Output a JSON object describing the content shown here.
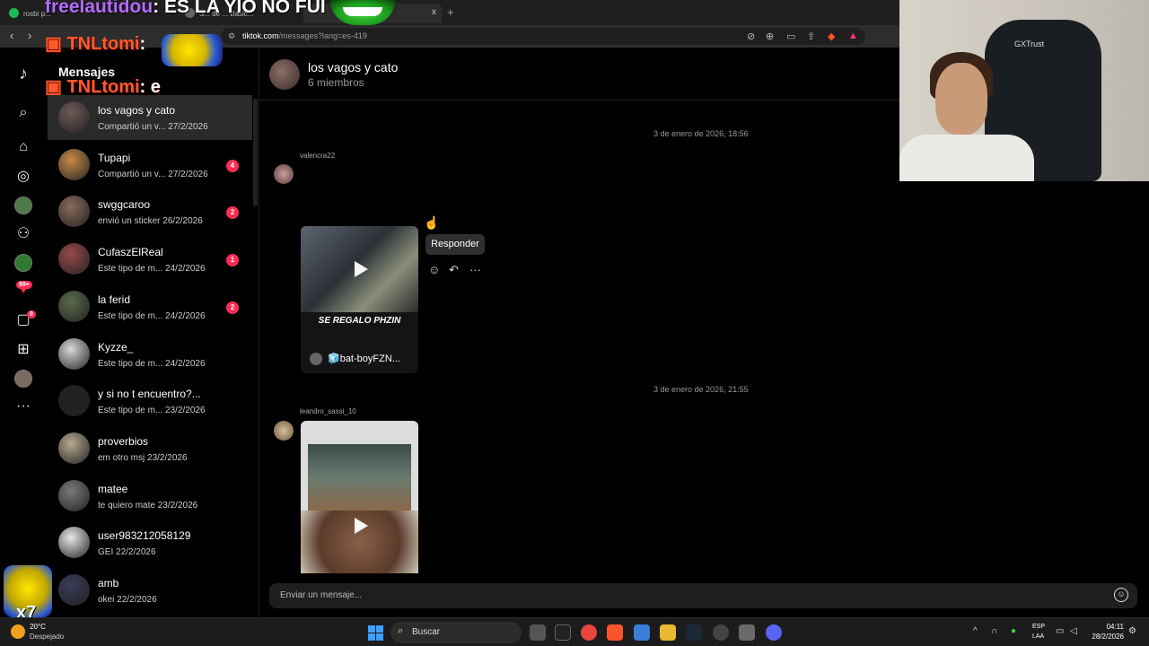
{
  "browser": {
    "tabs": [
      {
        "label": "rosbi p..."
      },
      {
        "label": "S... de ... Basic..."
      },
      {
        "label": "x"
      }
    ],
    "new_tab": "+",
    "url_host": "tiktok.com",
    "url_path": "/messages?lang=es-419",
    "nav": {
      "back": "‹",
      "forward": "›"
    }
  },
  "stream_overlay": {
    "banner_user": "freelautidou",
    "banner_text": ": ES LA YIO NO FUI",
    "tnl_line1_user": "TNLtomi",
    "tnl_line1_text": ":",
    "tnl_line2_user": "TNLtomi",
    "tnl_line2_text": ": e",
    "multiplier": "x7",
    "webcam_chair_brand": "GXTrust"
  },
  "sidebar": {
    "title": "Mensajes",
    "notif_badge": "99+",
    "inbox_badge": "9",
    "more": "···"
  },
  "conversations": [
    {
      "name": "los vagos y cato",
      "preview": "Compartió un v...",
      "date": "27/2/2026",
      "unread": "",
      "color": "#6e5a55"
    },
    {
      "name": "Tupapi",
      "preview": "Compartió un v...",
      "date": "27/2/2026",
      "unread": "4",
      "color": "#c98a4a"
    },
    {
      "name": "swggcaroo",
      "preview": "envió un sticker",
      "date": "26/2/2026",
      "unread": "2",
      "color": "#8a6a5a"
    },
    {
      "name": "CufaszElReal",
      "preview": "Este tipo de m...",
      "date": "24/2/2026",
      "unread": "1",
      "color": "#9a4a4a"
    },
    {
      "name": "la ferid",
      "preview": "Este tipo de m...",
      "date": "24/2/2026",
      "unread": "2",
      "color": "#5a6a4a"
    },
    {
      "name": "Kyzze_",
      "preview": "Este tipo de m...",
      "date": "24/2/2026",
      "unread": "",
      "color": "#d8d8d8"
    },
    {
      "name": "y si no t encuentro?...",
      "preview": "Este tipo de m...",
      "date": "23/2/2026",
      "unread": "",
      "color": "#222222"
    },
    {
      "name": "proverbios",
      "preview": "em otro msj",
      "date": "23/2/2026",
      "unread": "",
      "color": "#b8a890"
    },
    {
      "name": "matee",
      "preview": "te quiero mate",
      "date": "23/2/2026",
      "unread": "",
      "color": "#7a7a7a"
    },
    {
      "name": "user983212058129",
      "preview": "GEI",
      "date": "22/2/2026",
      "unread": "",
      "color": "#e8e8e8"
    },
    {
      "name": "amb",
      "preview": "okei",
      "date": "22/2/2026",
      "unread": "",
      "color": "#3a3a5a"
    }
  ],
  "chat": {
    "group_name": "los vagos y cato",
    "members": "6 miembros",
    "messages": [
      {
        "timestamp": "3 de enero de 2026, 18:56",
        "sender": "valencra22",
        "video_caption": "SE REGALO PHZIN",
        "video_author": "🧊bat-boyFZN..."
      },
      {
        "timestamp": "3 de enero de 2026, 21:55",
        "sender": "leandro_sassi_10"
      }
    ],
    "tooltip": "Responder",
    "composer_placeholder": "Enviar un mensaje..."
  },
  "taskbar": {
    "weather_temp": "20°C",
    "weather_cond": "Despejado",
    "search_label": "Buscar",
    "lang_top": "ESP",
    "lang_bottom": "LAA",
    "time": "04:11",
    "date": "28/2/2026"
  }
}
